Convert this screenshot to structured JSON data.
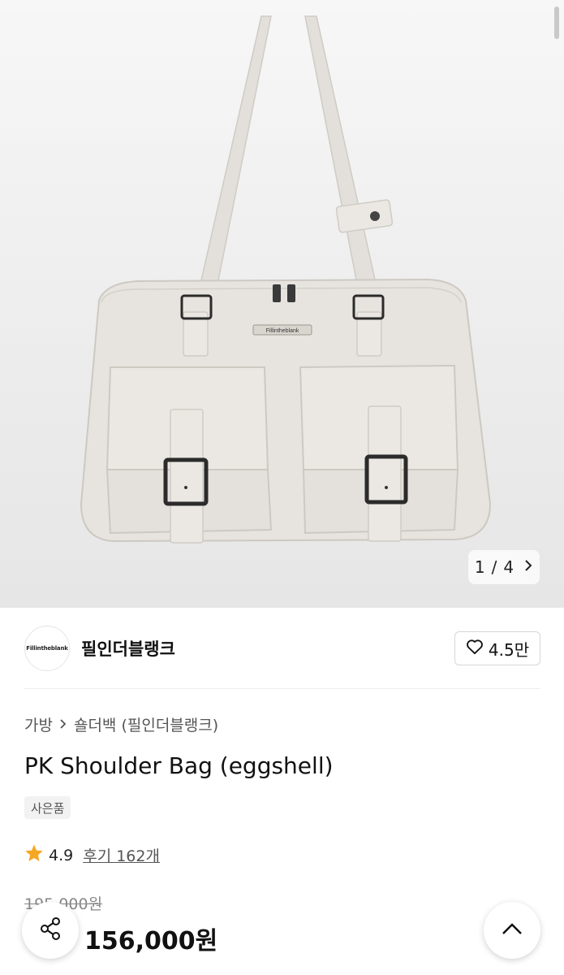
{
  "gallery": {
    "current": "1",
    "separator": "/",
    "total": "4",
    "image_logo_text": "Fillintheblank"
  },
  "store": {
    "logo_text": "Fillintheblank",
    "name": "필인더블랭크",
    "likes": "4.5만"
  },
  "breadcrumb": {
    "root": "가방",
    "leaf": "숄더백 (필인더블랭크)"
  },
  "product": {
    "title": "PK Shoulder Bag (eggshell)",
    "badge": "사은품",
    "rating": "4.9",
    "reviews": "후기 162개",
    "original_price": "195,000원",
    "price": "156,000원"
  },
  "icons": {
    "like": "heart-outline-icon",
    "star": "star-icon",
    "share": "share-icon",
    "scroll_top": "chevron-up-icon",
    "next": "chevron-right-icon"
  },
  "colors": {
    "star": "#f5a623",
    "bag_body": "#e6e3de",
    "hardware": "#2b2b2b"
  }
}
